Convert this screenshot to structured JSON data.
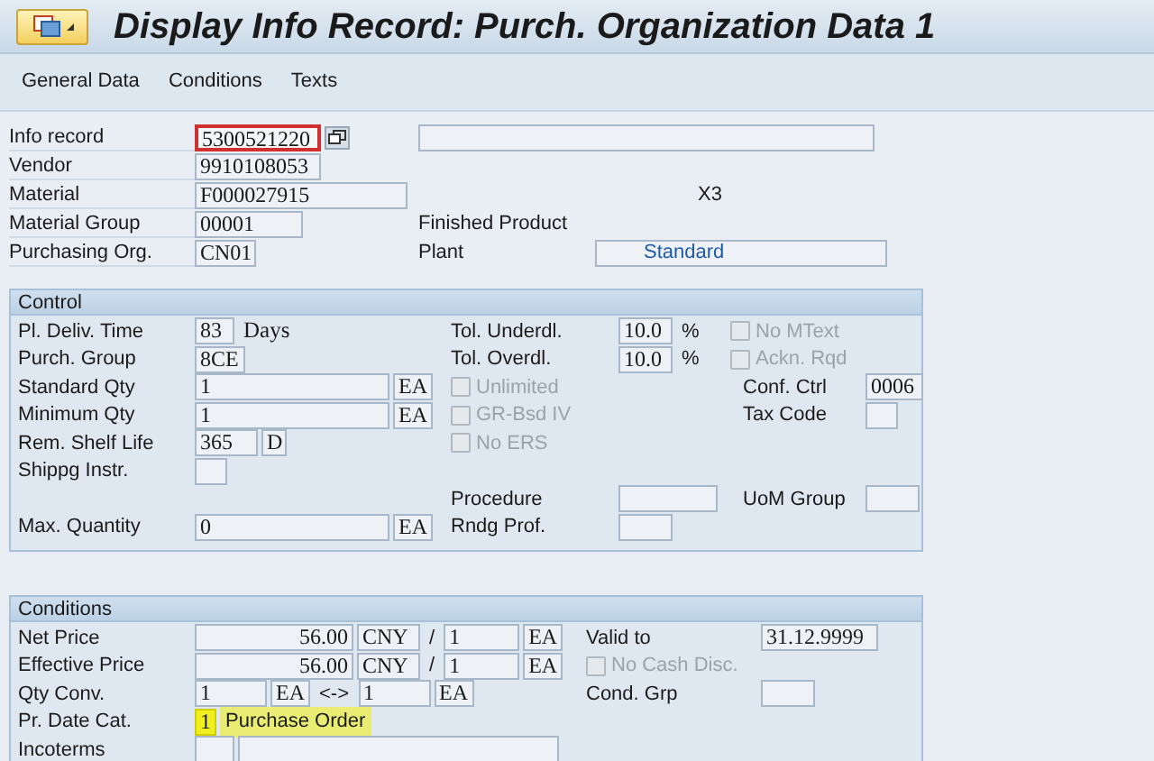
{
  "header": {
    "title": "Display Info Record: Purch. Organization Data 1"
  },
  "toolbar": {
    "buttons": [
      "General Data",
      "Conditions",
      "Texts"
    ]
  },
  "header_fields": [
    {
      "label": "Info record",
      "value": "5300521220",
      "focused": true
    },
    {
      "label": "Vendor",
      "value": "9910108053",
      "focused": false
    },
    {
      "label": "Material",
      "value": "F000027915",
      "focused": false
    },
    {
      "label": "Material Group",
      "value": "00001",
      "focused": false
    },
    {
      "label": "Purchasing Org.",
      "value": "CN01",
      "focused": false
    }
  ],
  "material_description": "X3",
  "material_group_text": "Finished Product",
  "plant": {
    "label": "Plant",
    "value": "Standard"
  },
  "control": {
    "title": "Control",
    "rows": [
      {
        "left": {
          "kind": "group",
          "label": "Pl. Deliv. Time",
          "items": [
            {
              "kind": "field",
              "text": "83"
            },
            {
              "kind": "text",
              "text": "Days"
            }
          ]
        },
        "middle": {
          "kind": "group",
          "label": "Tol. Underdl.",
          "items": [
            {
              "kind": "field",
              "text": "10.0"
            },
            {
              "kind": "text",
              "text": "%"
            }
          ]
        },
        "right": {
          "kind": "checkbox",
          "label": "No MText",
          "checked": false,
          "disabled": true
        }
      },
      {
        "left": {
          "kind": "group",
          "label": "Purch. Group",
          "items": [
            {
              "kind": "field",
              "text": "8CE"
            }
          ]
        },
        "middle": {
          "kind": "group",
          "label": "Tol. Overdl.",
          "items": [
            {
              "kind": "field",
              "text": "10.0"
            },
            {
              "kind": "text",
              "text": "%"
            }
          ]
        },
        "right": {
          "kind": "checkbox",
          "label": "Ackn. Rqd",
          "checked": false,
          "disabled": true
        }
      },
      {
        "left": {
          "kind": "group",
          "label": "Standard Qty",
          "items": [
            {
              "kind": "field",
              "text": "1"
            },
            {
              "kind": "field",
              "text": "EA"
            }
          ]
        },
        "middle": {
          "kind": "checkbox",
          "label": "Unlimited",
          "checked": false,
          "disabled": true
        },
        "right": {
          "kind": "group",
          "label": "Conf. Ctrl",
          "items": [
            {
              "kind": "field",
              "text": "0006"
            }
          ]
        }
      },
      {
        "left": {
          "kind": "group",
          "label": "Minimum Qty",
          "items": [
            {
              "kind": "field",
              "text": "1"
            },
            {
              "kind": "field",
              "text": "EA"
            }
          ]
        },
        "middle": {
          "kind": "checkbox",
          "label": "GR-Bsd IV",
          "checked": false,
          "disabled": true
        },
        "right": {
          "kind": "group",
          "label": "Tax Code",
          "items": [
            {
              "kind": "field"
            }
          ]
        }
      },
      {
        "left": {
          "kind": "group",
          "label": "Rem. Shelf Life",
          "items": [
            {
              "kind": "field",
              "text": "365"
            },
            {
              "kind": "field",
              "text": "D"
            }
          ]
        },
        "middle": {
          "kind": "checkbox",
          "label": "No ERS",
          "checked": false,
          "disabled": true
        }
      },
      {
        "left": {
          "kind": "group",
          "label": "Shippg Instr.",
          "items": [
            {
              "kind": "field"
            }
          ]
        }
      },
      {
        "middle": {
          "kind": "group",
          "label": "Procedure",
          "items": [
            {
              "kind": "field"
            }
          ]
        },
        "right": {
          "kind": "group",
          "label": "UoM Group",
          "items": [
            {
              "kind": "field"
            }
          ]
        }
      },
      {
        "left": {
          "kind": "group",
          "label": "Max. Quantity",
          "items": [
            {
              "kind": "field",
              "text": "0"
            },
            {
              "kind": "field",
              "text": "EA"
            }
          ]
        },
        "middle": {
          "kind": "group",
          "label": "Rndg Prof.",
          "items": [
            {
              "kind": "field"
            }
          ]
        }
      }
    ]
  },
  "conditions": {
    "title": "Conditions",
    "rows": [
      {
        "left": {
          "kind": "group",
          "label": "Net Price",
          "items": [
            {
              "kind": "field",
              "text": "56.00"
            },
            {
              "kind": "field",
              "text": "CNY"
            },
            {
              "kind": "text",
              "text": "/"
            },
            {
              "kind": "field",
              "text": "1"
            },
            {
              "kind": "field",
              "text": "EA"
            }
          ]
        },
        "middle": {
          "kind": "group",
          "label": "Valid to",
          "items": [
            {
              "kind": "field",
              "text": "31.12.9999"
            }
          ]
        }
      },
      {
        "left": {
          "kind": "group",
          "label": "Effective Price",
          "items": [
            {
              "kind": "field",
              "text": "56.00"
            },
            {
              "kind": "field",
              "text": "CNY"
            },
            {
              "kind": "text",
              "text": "/"
            },
            {
              "kind": "field",
              "text": "1"
            },
            {
              "kind": "field",
              "text": "EA"
            }
          ]
        },
        "middle": {
          "kind": "checkbox",
          "label": "No Cash Disc.",
          "checked": false,
          "disabled": true
        }
      },
      {
        "left": {
          "kind": "group",
          "label": "Qty Conv.",
          "items": [
            {
              "kind": "field",
              "text": "1"
            },
            {
              "kind": "field",
              "text": "EA"
            },
            {
              "kind": "text",
              "text": "<->"
            },
            {
              "kind": "field",
              "text": "1"
            },
            {
              "kind": "field",
              "text": "EA"
            }
          ]
        },
        "middle": {
          "kind": "group",
          "label": "Cond. Grp",
          "items": [
            {
              "kind": "field"
            }
          ]
        }
      },
      {
        "left": {
          "kind": "group",
          "label": "Pr. Date Cat.",
          "highlighted": true,
          "items": [
            {
              "kind": "field",
              "text": "1"
            },
            {
              "kind": "text",
              "text": "Purchase Order"
            }
          ]
        }
      },
      {
        "left": {
          "kind": "group",
          "label": "Incoterms",
          "items": [
            {
              "kind": "field"
            },
            {
              "kind": "field"
            }
          ]
        }
      }
    ]
  }
}
